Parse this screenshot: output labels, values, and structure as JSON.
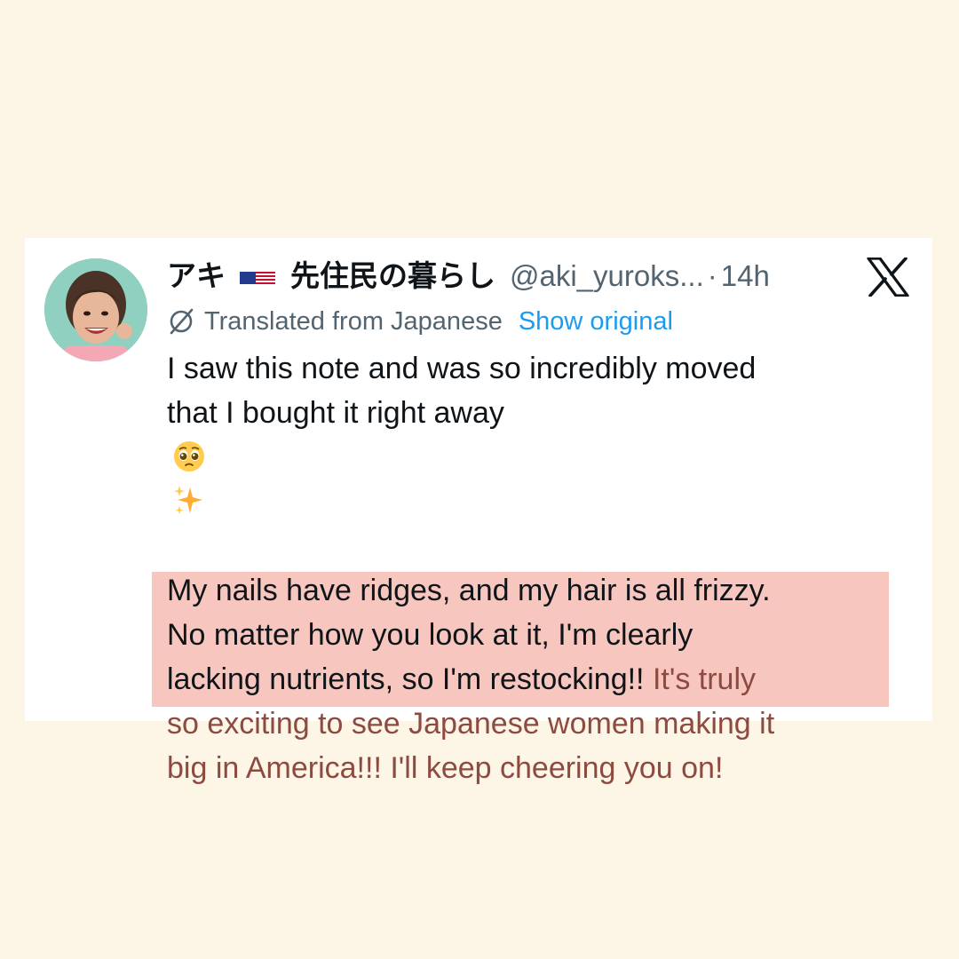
{
  "post": {
    "display_name": "アキ",
    "display_name_suffix": "先住民の暮らし",
    "handle": "@aki_yuroks...",
    "separator": "·",
    "timestamp": "14h",
    "platform_icon": "x-logo-icon",
    "translation": {
      "label": "Translated from Japanese",
      "show_original": "Show original"
    },
    "text": {
      "line_1": "I saw this note and was so incredibly moved",
      "line_2": "that I bought it right away",
      "para_2_plain": "My nails have ridges, and my hair is all frizzy.\nNo matter how you look at it, I'm clearly\nlacking nutrients, so I'm restocking!! ",
      "para_2_highlight_1": "It's truly",
      "para_2_highlight_2": "so exciting to see Japanese women making it\nbig in America!!! I'll keep cheering you on!"
    },
    "emojis": [
      "pleading-face-emoji",
      "sparkles-emoji"
    ],
    "highlight_color": "#f7c7bf"
  },
  "colors": {
    "background": "#fdf5e6",
    "card": "#ffffff",
    "primary_text": "#0f1419",
    "secondary_text": "#536471",
    "link": "#1d9bf0"
  }
}
